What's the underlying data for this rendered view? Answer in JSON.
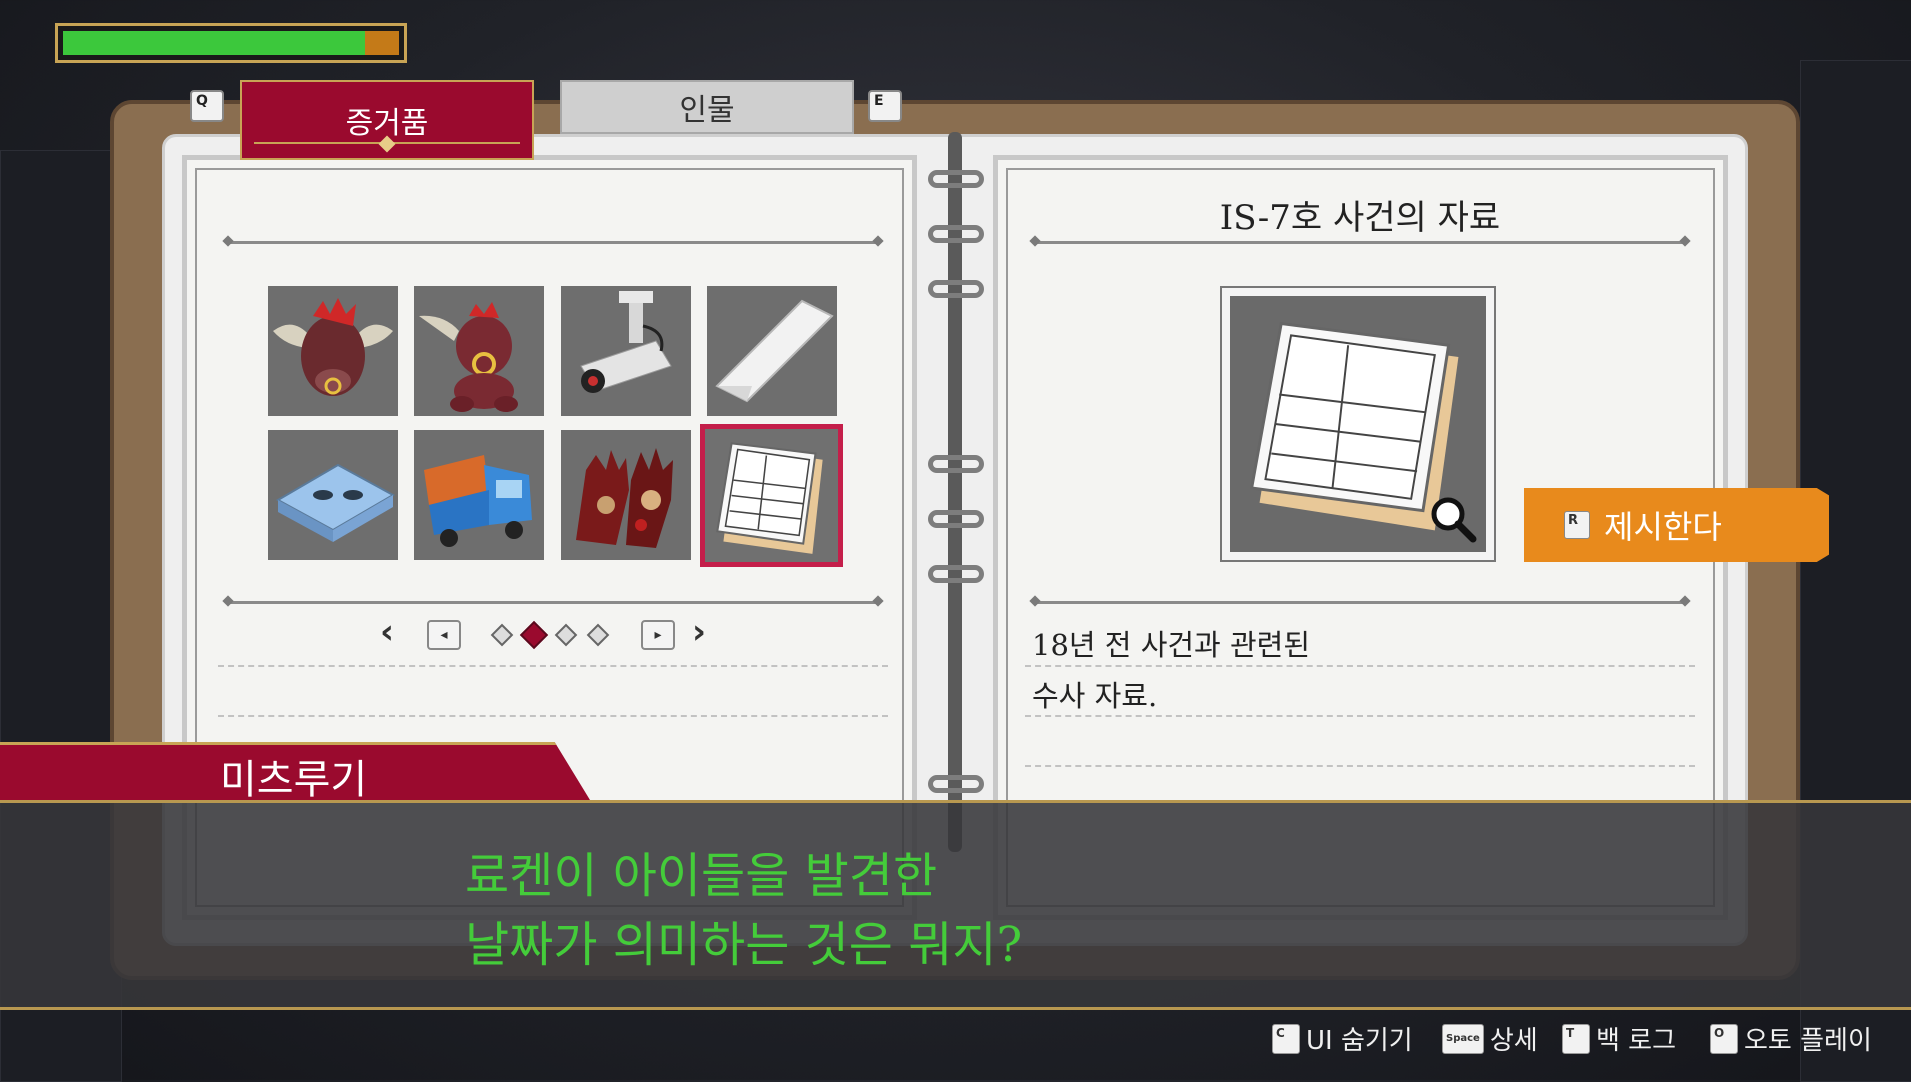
{
  "status": {
    "health_fraction": 0.9
  },
  "tabs": {
    "prev_key": "Q",
    "next_key": "E",
    "evidence_label": "증거품",
    "people_label": "인물"
  },
  "evidence": {
    "items": [
      {
        "icon": "bull-head-icon"
      },
      {
        "icon": "bull-plush-icon"
      },
      {
        "icon": "security-camera-icon"
      },
      {
        "icon": "envelope-icon"
      },
      {
        "icon": "videotape-icon"
      },
      {
        "icon": "truck-icon"
      },
      {
        "icon": "bloody-gloves-icon"
      },
      {
        "icon": "documents-icon",
        "selected": true
      }
    ],
    "pager": {
      "page_count": 4,
      "current_page": 2
    }
  },
  "detail": {
    "title": "IS-7호 사건의 자료",
    "description_line1": "18년 전 사건과 관련된",
    "description_line2": "수사 자료.",
    "present_key": "R",
    "present_label": "제시한다"
  },
  "dialogue": {
    "speaker": "미츠루기",
    "line1": "료켄이 아이들을 발견한",
    "line2": "날짜가 의미하는 것은 뭐지?"
  },
  "help": [
    {
      "key": "C",
      "label": "UI 숨기기"
    },
    {
      "key": "Space",
      "label": "상세"
    },
    {
      "key": "T",
      "label": "백 로그"
    },
    {
      "key": "O",
      "label": "오토 플레이"
    }
  ],
  "colors": {
    "accent_red": "#9a0a2e",
    "present_orange": "#e88a1c",
    "dialogue_green": "#44cc3a",
    "gold": "#c8a455"
  }
}
